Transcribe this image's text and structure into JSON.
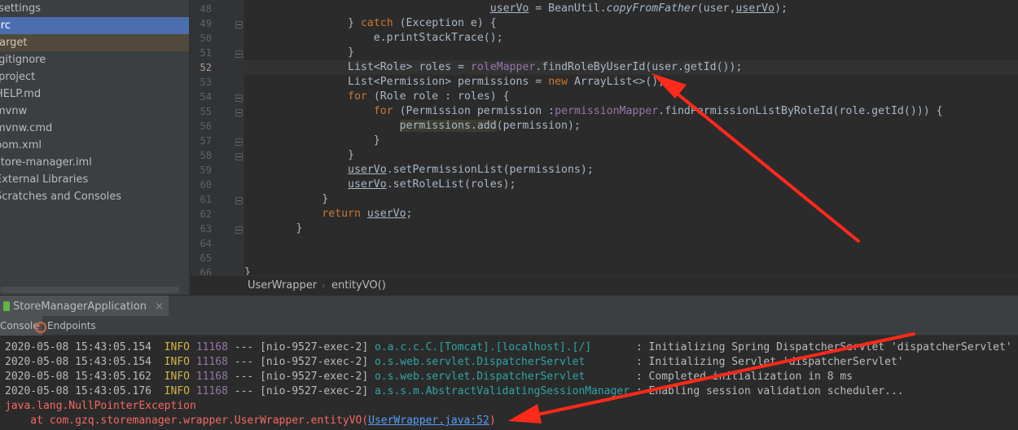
{
  "project_tree": {
    "items": [
      {
        "label": ".settings",
        "state": "normal"
      },
      {
        "label": "src",
        "state": "selected"
      },
      {
        "label": "target",
        "state": "excluded"
      },
      {
        "label": ".gitignore",
        "state": "normal"
      },
      {
        "label": ".project",
        "state": "normal"
      },
      {
        "label": "HELP.md",
        "state": "normal"
      },
      {
        "label": "mvnw",
        "state": "normal"
      },
      {
        "label": "mvnw.cmd",
        "state": "normal"
      },
      {
        "label": "pom.xml",
        "state": "normal"
      },
      {
        "label": "store-manager.iml",
        "state": "normal"
      },
      {
        "label": "External Libraries",
        "state": "normal"
      },
      {
        "label": "Scratches and Consoles",
        "state": "normal"
      }
    ]
  },
  "editor": {
    "line_numbers": [
      "48",
      "49",
      "50",
      "51",
      "52",
      "53",
      "54",
      "55",
      "56",
      "57",
      "58",
      "59",
      "60",
      "61",
      "62",
      "63",
      "64",
      "65",
      "66"
    ],
    "current_line_number": "52",
    "code": {
      "l48_var": "userVo",
      "l48_mid": " = BeanUtil.",
      "l48_call": "copyFromFather",
      "l48_args_a": "(user,",
      "l48_args_b": "userVo",
      "l48_end": ");",
      "l49_close": "} ",
      "l49_kw": "catch",
      "l49_rest": " (Exception e) {",
      "l50": "e.printStackTrace();",
      "l51": "}",
      "l52_a": "List<Role> roles = ",
      "l52_field": "roleMapper",
      "l52_b": ".findRoleByUserId(user.getId());",
      "l53_a": "List<Permission> permissions = ",
      "l53_kw": "new",
      "l53_b": " ArrayList<>();",
      "l54_kw": "for",
      "l54_rest": " (Role role : roles) {",
      "l55_kw": "for",
      "l55_a": " (Permission permission :",
      "l55_field": "permissionMapper",
      "l55_b": ".findPermissionListByRoleId(role.getId())) {",
      "l56_hl": "permissions.add",
      "l56_rest": "(permission);",
      "l57": "}",
      "l58": "}",
      "l59_var": "userVo",
      "l59_rest": ".setPermissionList(permissions);",
      "l60_var": "userVo",
      "l60_rest": ".setRoleList(roles);",
      "l61": "}",
      "l62_kw": "return",
      "l62_var": "userVo",
      "l62_end": ";",
      "l63": "}",
      "l66": "}"
    }
  },
  "breadcrumb": {
    "class_name": "UserWrapper",
    "separator": "›",
    "method_name": "entityVO()"
  },
  "run_window": {
    "tab_label": "StoreManagerApplication",
    "close_glyph": "×",
    "subtabs": {
      "console": "Console",
      "endpoints": "Endpoints"
    }
  },
  "console": {
    "lines": [
      {
        "time": "2020-05-08 15:43:05.154",
        "level": "INFO",
        "pid": "11168",
        "dash": " --- ",
        "thread": "[nio-9527-exec-2]",
        "logger": "o.a.c.c.C.[Tomcat].[localhost].[/]      ",
        "message": " : Initializing Spring DispatcherServlet 'dispatcherServlet'"
      },
      {
        "time": "2020-05-08 15:43:05.154",
        "level": "INFO",
        "pid": "11168",
        "dash": " --- ",
        "thread": "[nio-9527-exec-2]",
        "logger": "o.s.web.servlet.DispatcherServlet       ",
        "message": " : Initializing Servlet 'dispatcherServlet'"
      },
      {
        "time": "2020-05-08 15:43:05.162",
        "level": "INFO",
        "pid": "11168",
        "dash": " --- ",
        "thread": "[nio-9527-exec-2]",
        "logger": "o.s.web.servlet.DispatcherServlet       ",
        "message": " : Completed initialization in 8 ms"
      },
      {
        "time": "2020-05-08 15:43:05.176",
        "level": "INFO",
        "pid": "11168",
        "dash": " --- ",
        "thread": "[nio-9527-exec-2]",
        "logger": "a.s.s.m.AbstractValidatingSessionManager",
        "message": " : Enabling session validation scheduler..."
      }
    ],
    "exception": "java.lang.NullPointerException",
    "stack_prefix": "    at com.gzq.storemanager.wrapper.UserWrapper.entityVO(",
    "stack_link": "UserWrapper.java:52",
    "stack_suffix": ")"
  },
  "colors": {
    "annotation_arrow": "#ff2a1a"
  }
}
